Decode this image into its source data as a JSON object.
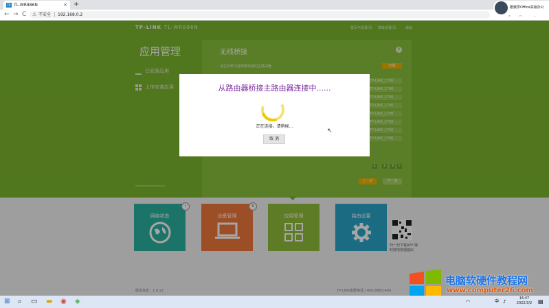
{
  "browser": {
    "tab_title": "TL-WR886N",
    "tab_close": "×",
    "new_tab": "+",
    "nav_back": "←",
    "nav_forward": "→",
    "nav_reload": "C",
    "security_label": "不安全",
    "url": "192.168.0.2",
    "profile_name": "跟我学Office高级办公",
    "win_min": "—",
    "win_max": "□",
    "win_close": "×"
  },
  "router": {
    "logo": "TP-LINK",
    "model": "TL-WR886N",
    "top_links": [
      "首页与登录/页",
      "高级设置/页",
      "退出"
    ],
    "app_title": "应用管理",
    "side_items": [
      "已安装应用",
      "上传安装应用"
    ],
    "panel_title": "无线桥接",
    "panel_desc": "请在列表中选择要桥接的主路由器",
    "scan_btn": "扫描",
    "list_rows": [
      "TP-LINK_2706",
      "TP-LINK_2706",
      "TP-LINK_2706",
      "TP-LINK_2706",
      "TP-LINK_2706",
      "TP-LINK_2706",
      "TP-LINK_2706",
      "TP-LINK_2706"
    ],
    "pager": [
      "1",
      "2",
      "3",
      "»"
    ],
    "prev_btn": "上一步",
    "next_btn": "下一步",
    "tiles": [
      {
        "label": "网络状态",
        "color": "#2bb3a0"
      },
      {
        "label": "设备管理",
        "color": "#f07a3c"
      },
      {
        "label": "应用管理",
        "color": "#8fbf3a"
      },
      {
        "label": "路由设置",
        "color": "#2aa6c8"
      }
    ],
    "badges": [
      "!",
      "5"
    ],
    "qr_text": "扫一扫下载APP 随时随地管理路由",
    "footer_left": "版本信息：1.0.12",
    "footer_right": "TP-LINK客服电话 | 400-8863-400"
  },
  "dialog": {
    "title": "从路由器桥接主路由器连接中......",
    "status": "正在连接，请稍候...",
    "cancel": "取 消"
  },
  "watermark": {
    "text": "电脑软硬件教程网",
    "url": "www.computer26.com"
  },
  "taskbar": {
    "time": "16:47",
    "date": "2022/3/2",
    "lang": "中"
  }
}
